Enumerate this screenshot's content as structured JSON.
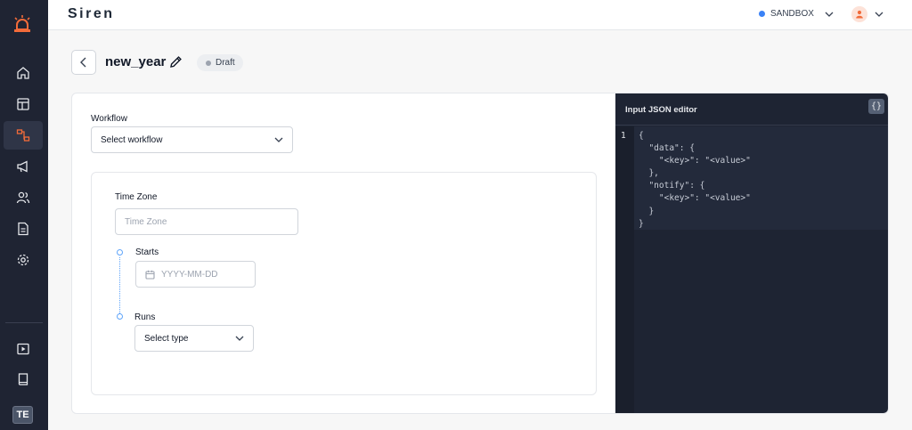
{
  "app": {
    "brand": "Siren"
  },
  "topbar": {
    "environment": "SANDBOX",
    "env_dot_color": "#3b82f6"
  },
  "sidebar": {
    "items": [
      "home-icon",
      "dashboard-icon",
      "workflow-icon",
      "megaphone-icon",
      "users-icon",
      "document-icon",
      "settings-icon"
    ],
    "active": "workflow-icon",
    "bottom": [
      "video-icon",
      "book-icon"
    ],
    "user_initials": "TE"
  },
  "header": {
    "title": "new_year",
    "status": "Draft"
  },
  "form": {
    "workflow_label": "Workflow",
    "workflow_value": "Select workflow",
    "timezone_label": "Time Zone",
    "timezone_placeholder": "Time Zone",
    "starts_label": "Starts",
    "starts_placeholder": "YYYY-MM-DD",
    "runs_label": "Runs",
    "runs_value": "Select type"
  },
  "editor": {
    "title": "Input JSON editor",
    "braces_label": "{}",
    "line_number": "1",
    "code": "{\n  \"data\": {\n    \"<key>\": \"<value>\"\n  },\n  \"notify\": {\n    \"<key>\": \"<value>\"\n  }\n}"
  }
}
